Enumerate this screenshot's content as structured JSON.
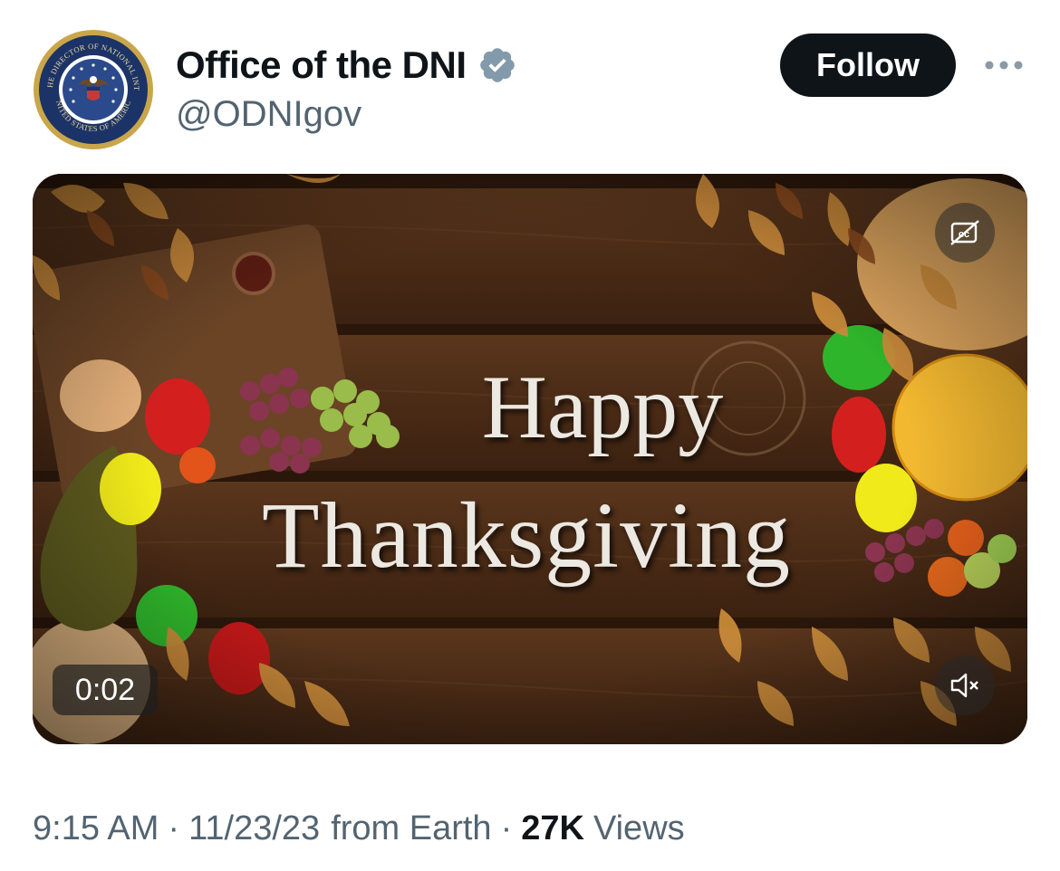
{
  "author": {
    "display_name": "Office of the DNI",
    "handle": "@ODNIgov",
    "avatar_icon": "odni-seal-icon",
    "seal_top_text": "OFFICE OF THE DIRECTOR OF NATIONAL INTELLIGENCE",
    "seal_bottom_text": "UNITED STATES OF AMERICA",
    "verified_color": "#829aab"
  },
  "header": {
    "follow_label": "Follow",
    "more_icon": "more-horizontal-icon"
  },
  "media": {
    "line1": "Happy",
    "line2": "Thanksgiving",
    "elapsed": "0:02",
    "cc_icon": "closed-captions-icon",
    "mute_icon": "volume-muted-icon"
  },
  "meta": {
    "time": "9:15 AM",
    "separator": "·",
    "date": "11/23/23",
    "source": "from Earth",
    "views_count": "27K",
    "views_label": "Views"
  },
  "colors": {
    "follow_bg": "#0f1419",
    "secondary_text": "#536471",
    "wood": "#4a2c18"
  }
}
